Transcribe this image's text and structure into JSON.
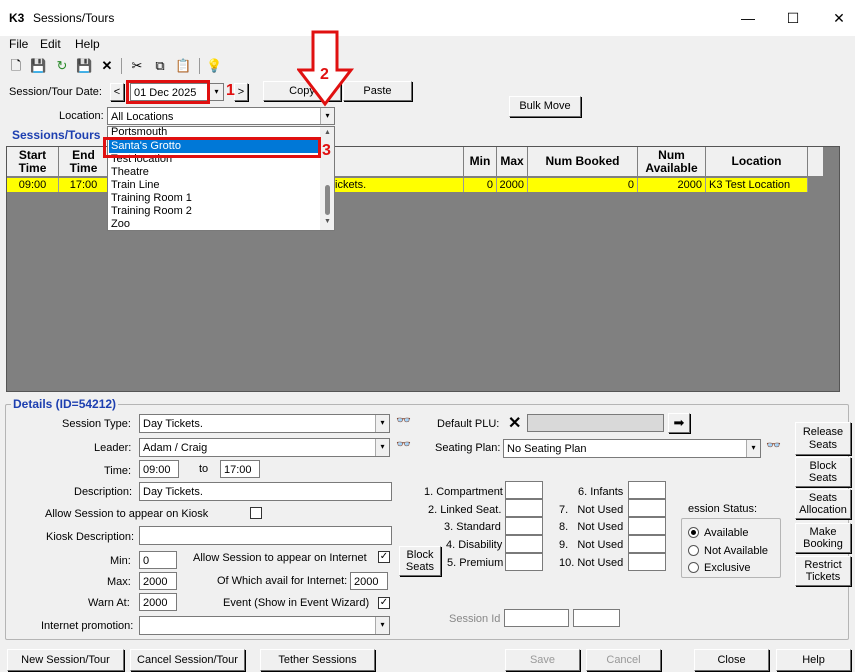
{
  "window": {
    "logo": "K3",
    "title": "Sessions/Tours",
    "minimize": "—",
    "maximize": "☐",
    "close": "✕"
  },
  "menu": [
    "File",
    "Edit",
    "Help"
  ],
  "toolbar": {
    "new": "🗋",
    "save_all": "💾",
    "refresh": "↻",
    "save": "💾",
    "delete": "✕",
    "cut": "✂",
    "copy": "⧉",
    "paste": "📋",
    "help": "💡"
  },
  "date_row": {
    "label": "Session/Tour Date:",
    "prev": "<",
    "date": "01 Dec 2025",
    "dd": "▾",
    "next": ">",
    "copy": "Copy",
    "paste": "Paste"
  },
  "location_row": {
    "label": "Location:",
    "value": "All Locations",
    "dd": "▾",
    "bulk_move": "Bulk Move"
  },
  "location_list": [
    "Portsmouth",
    "Santa's Grotto",
    "Test location",
    "Theatre",
    "Train Line",
    "Training Room 1",
    "Training Room 2",
    "Zoo"
  ],
  "annotations": {
    "n1": "1",
    "n2": "2",
    "n3": "3",
    "arrow": "⇩"
  },
  "sessions": {
    "title": "Sessions/Tours",
    "columns": [
      "Start Time",
      "End Time",
      "Description",
      "Min",
      "Max",
      "Num Booked",
      "Num Available",
      "Location"
    ],
    "rows": [
      {
        "start": "09:00",
        "end": "17:00",
        "desc": "ickets.",
        "min": "0",
        "max": "2000",
        "booked": "0",
        "avail": "2000",
        "loc": "K3 Test Location"
      }
    ]
  },
  "details": {
    "title": "Details (ID=54212)",
    "session_type_label": "Session Type:",
    "session_type": "Day Tickets.",
    "leader_label": "Leader:",
    "leader": "Adam / Craig",
    "time_label": "Time:",
    "time_from": "09:00",
    "to": "to",
    "time_to": "17:00",
    "desc_label": "Description:",
    "desc": "Day Tickets.",
    "allow_kiosk": "Allow Session to appear on Kiosk",
    "kiosk_desc_label": "Kiosk Description:",
    "kiosk_desc": "",
    "min_label": "Min:",
    "min": "0",
    "allow_internet": "Allow Session to appear on Internet",
    "internet_check": "✓",
    "max_label": "Max:",
    "max": "2000",
    "avail_internet_label": "Of Which avail for Internet:",
    "avail_internet": "2000",
    "warn_label": "Warn At:",
    "warn": "2000",
    "event_label": "Event (Show in Event Wizard)",
    "event_check": "✓",
    "promo_label": "Internet promotion:",
    "promo": "",
    "plu_label": "Default PLU:",
    "plu_clear": "✕",
    "plu_go": "➡",
    "seating_label": "Seating Plan:",
    "seating": "No Seating Plan",
    "block_seats": "Block Seats",
    "seat_types_left": [
      "1. Compartment",
      "2. Linked Seat.",
      "3. Standard",
      "4. Disability",
      "5. Premium"
    ],
    "seat_types_right": [
      "6. Infants",
      "7.   Not Used",
      "8.   Not Used",
      "9.   Not Used",
      "10. Not Used"
    ],
    "status_label": "ession Status:",
    "status_options": [
      "Available",
      "Not Available",
      "Exclusive"
    ],
    "session_id_label": "Session Id",
    "side_buttons": [
      "Release Seats",
      "Block Seats",
      "Seats Allocation",
      "Make Booking",
      "Restrict Tickets"
    ]
  },
  "bottom_buttons": {
    "new": "New Session/Tour",
    "cancel_session": "Cancel Session/Tour",
    "tether": "Tether Sessions",
    "save": "Save",
    "cancel": "Cancel",
    "close": "Close",
    "help": "Help"
  },
  "colors": {
    "selected_row": "#ffff00",
    "highlight": "#0078d7",
    "annotation": "#e01010",
    "section_title": "#1d3fb0"
  }
}
